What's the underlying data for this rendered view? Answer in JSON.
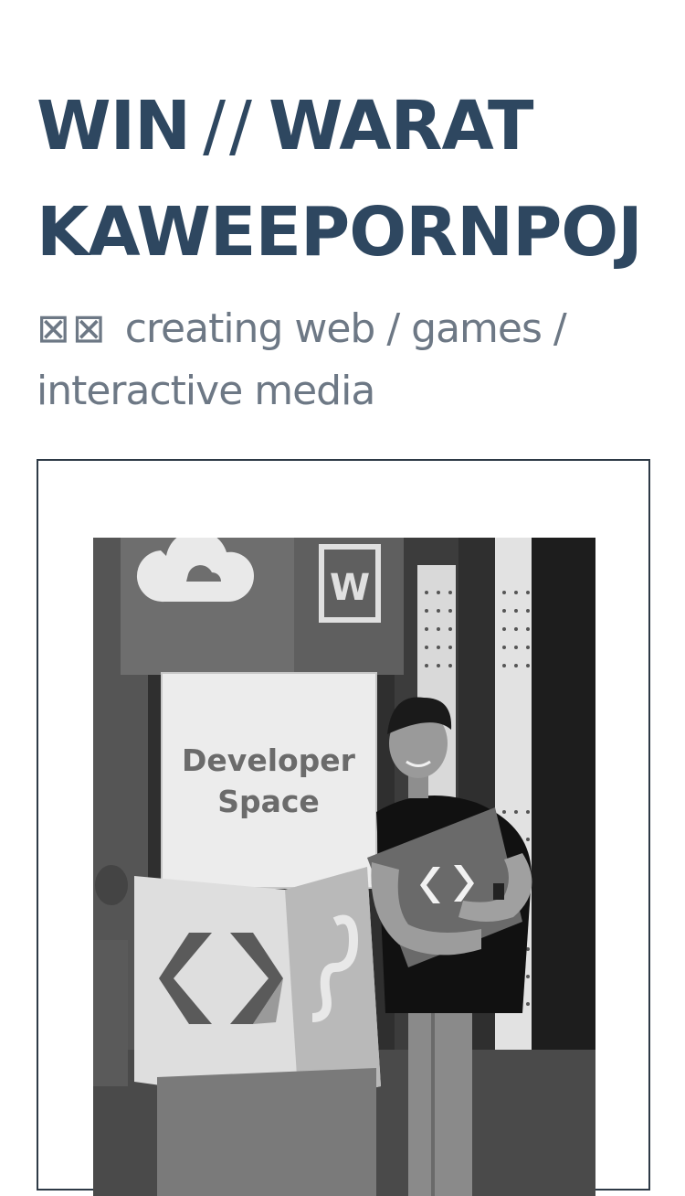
{
  "header": {
    "name_first": "WIN",
    "separator": "//",
    "name_line1": "WARAT",
    "name_line2": "KAWEEPORNPOJ",
    "tagline_glyphs": "⊠⊠",
    "tagline_line1": "creating web / games /",
    "tagline_line2": "interactive media"
  },
  "photo": {
    "sign_line1": "Developer",
    "sign_line2": "Space"
  },
  "colors": {
    "heading": "#2e4760",
    "tagline": "#6d7885",
    "frame_border": "#2e3a46"
  }
}
